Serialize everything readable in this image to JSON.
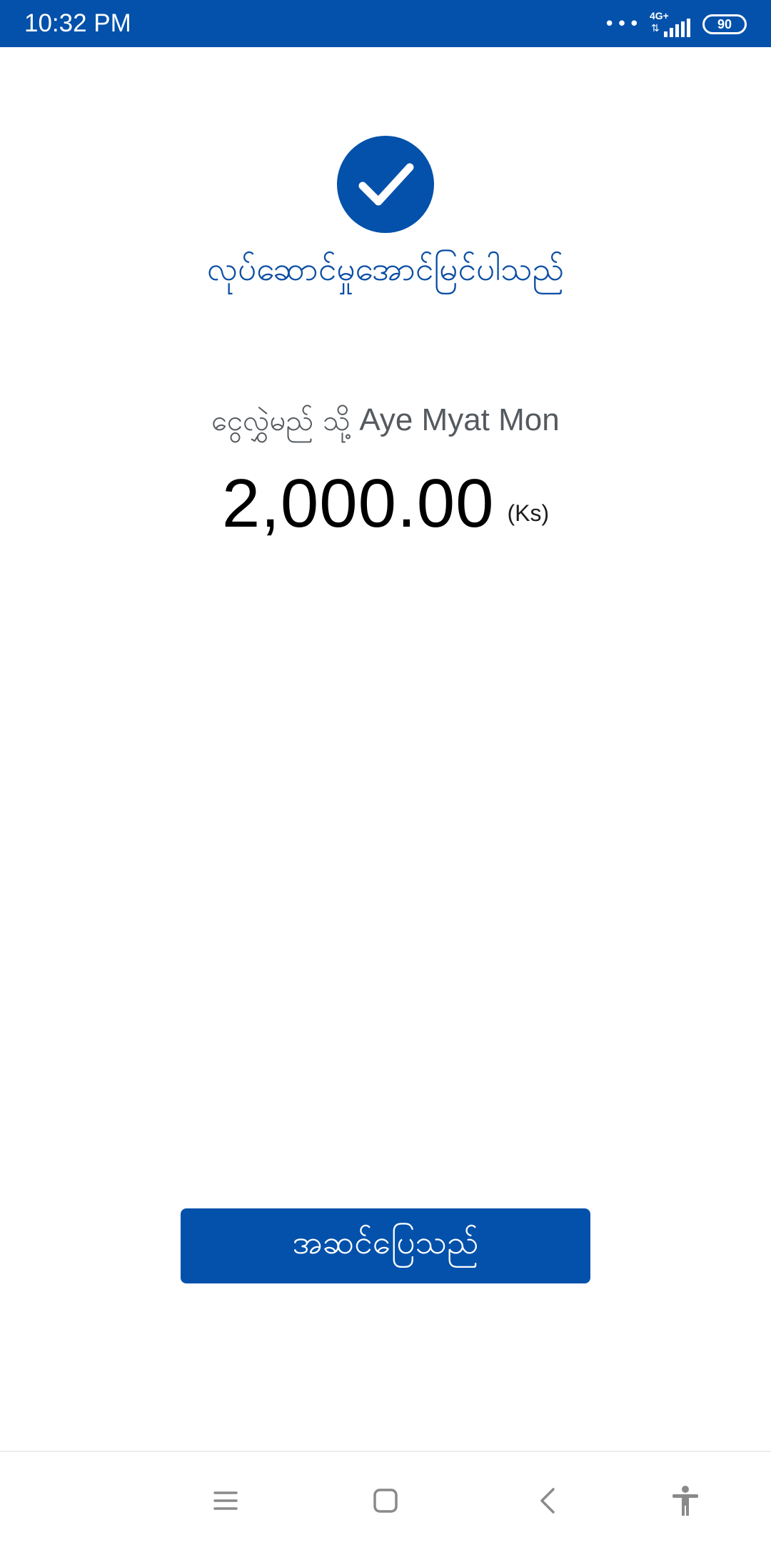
{
  "status_bar": {
    "time": "10:32 PM",
    "more_dots": "•••",
    "network_type": "4G+",
    "network_arrows": "⇅",
    "battery_level": "90"
  },
  "success": {
    "icon": "check-icon",
    "title": "လုပ်ဆောင်မှုအောင်မြင်ပါသည်"
  },
  "transfer": {
    "recipient_prefix": "ငွေလွှဲမည် သို့",
    "recipient_name": "Aye Myat Mon",
    "amount": "2,000.00",
    "currency": "(Ks)"
  },
  "actions": {
    "done_label": "အဆင်ပြေသည်"
  },
  "nav_bar": {
    "icons": [
      "menu-icon",
      "home-icon",
      "back-icon",
      "accessibility-icon"
    ]
  },
  "colors": {
    "brand": "#0351ab",
    "title_text": "#0b4ea3",
    "secondary_text": "#555a5f",
    "amount_text": "#000000",
    "nav_icon": "#8a8a8a"
  }
}
